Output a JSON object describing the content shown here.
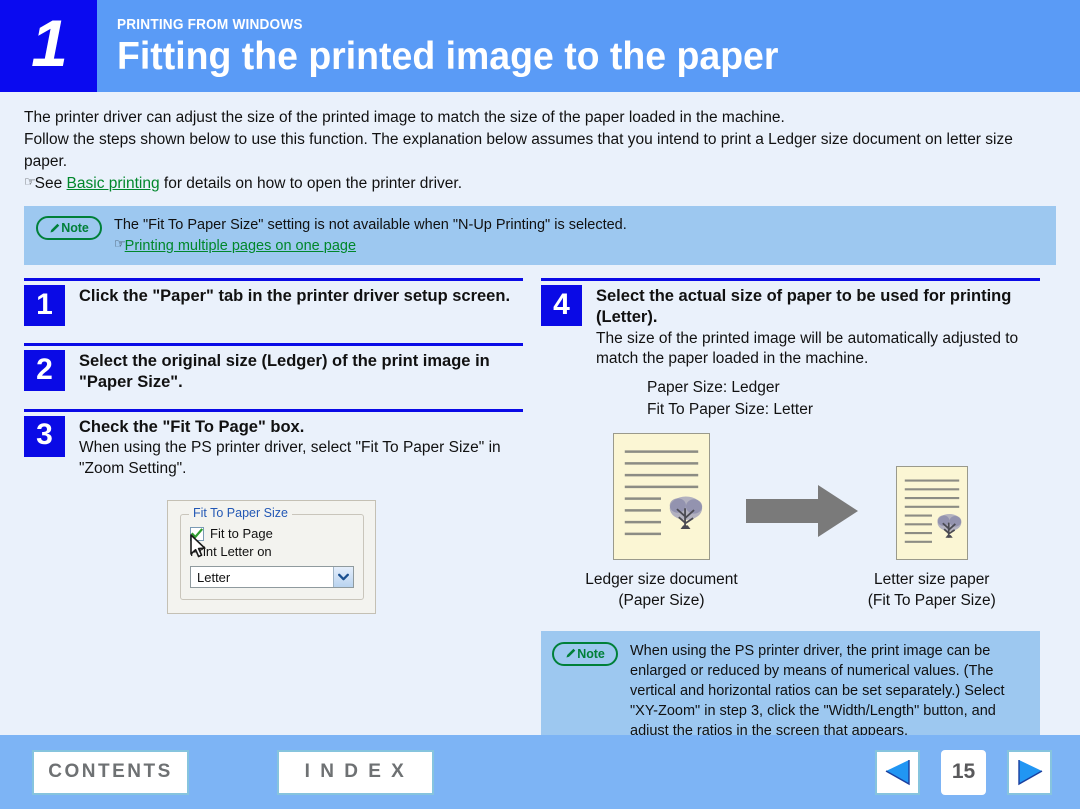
{
  "header": {
    "number": "1",
    "kicker": "PRINTING FROM WINDOWS",
    "title": "Fitting the printed image to the paper",
    "bg_color": "#5a9bf6",
    "num_bg_color": "#0a0af0"
  },
  "intro": {
    "line1": "The printer driver can adjust the size of the printed image to match the size of the paper loaded in the machine.",
    "line2": "Follow the steps shown below to use this function. The explanation below assumes that you intend to print a Ledger size document on letter size paper.",
    "see_prefix": "See ",
    "see_link": "Basic printing",
    "see_suffix": " for details on how to open the printer driver.",
    "hand_glyph": "☞"
  },
  "note_top": {
    "icon_label": "Note",
    "text": "The \"Fit To Paper Size\" setting is not available when \"N-Up Printing\" is selected.",
    "link": "Printing multiple pages on one page",
    "hand_glyph": "☞",
    "bg_color": "#9dc8f0",
    "icon_color": "#008039"
  },
  "steps_left": [
    {
      "number": "1",
      "heading": "Click the \"Paper\" tab in the printer driver setup screen.",
      "sub": ""
    },
    {
      "number": "2",
      "heading": "Select the original size (Ledger) of the print image in \"Paper Size\".",
      "sub": ""
    },
    {
      "number": "3",
      "heading": "Check the \"Fit To Page\" box.",
      "sub": "When using the PS printer driver, select \"Fit To Paper Size\" in \"Zoom Setting\"."
    }
  ],
  "dialog": {
    "group_legend": "Fit To Paper Size",
    "checkbox_label_a": "Fit to Pa",
    "checkbox_label_underline": "g",
    "checkbox_label_b": "e",
    "checkbox_checked": true,
    "print_on_label": "Print Letter on",
    "combo_value": "Letter",
    "combo_options": [
      "Letter"
    ]
  },
  "steps_right": [
    {
      "number": "4",
      "heading": "Select the actual size of paper to be used for printing (Letter).",
      "sub": "The size of the printed image will be automatically adjusted to match the paper loaded in the machine."
    }
  ],
  "paper_spec": {
    "line1": "Paper Size: Ledger",
    "line2": "Fit To Paper Size: Letter"
  },
  "illustration": {
    "left_caption_line1": "Ledger size document",
    "left_caption_line2": "(Paper Size)",
    "right_caption_line1": "Letter size paper",
    "right_caption_line2": "(Fit To Paper Size)",
    "sheet_color": "#fbf6d4",
    "arrow_color": "#7a7a7a"
  },
  "note_bottom": {
    "icon_label": "Note",
    "text": "When using the PS printer driver, the print image can be enlarged or reduced by means of numerical values. (The vertical and horizontal ratios can be set separately.) Select \"XY-Zoom\" in step 3, click the \"Width/Length\" button, and adjust the ratios in the screen that appears."
  },
  "footer": {
    "contents_label": "CONTENTS",
    "index_label": "I N D E X",
    "page_number": "15",
    "bg_color": "#7db4f5"
  }
}
